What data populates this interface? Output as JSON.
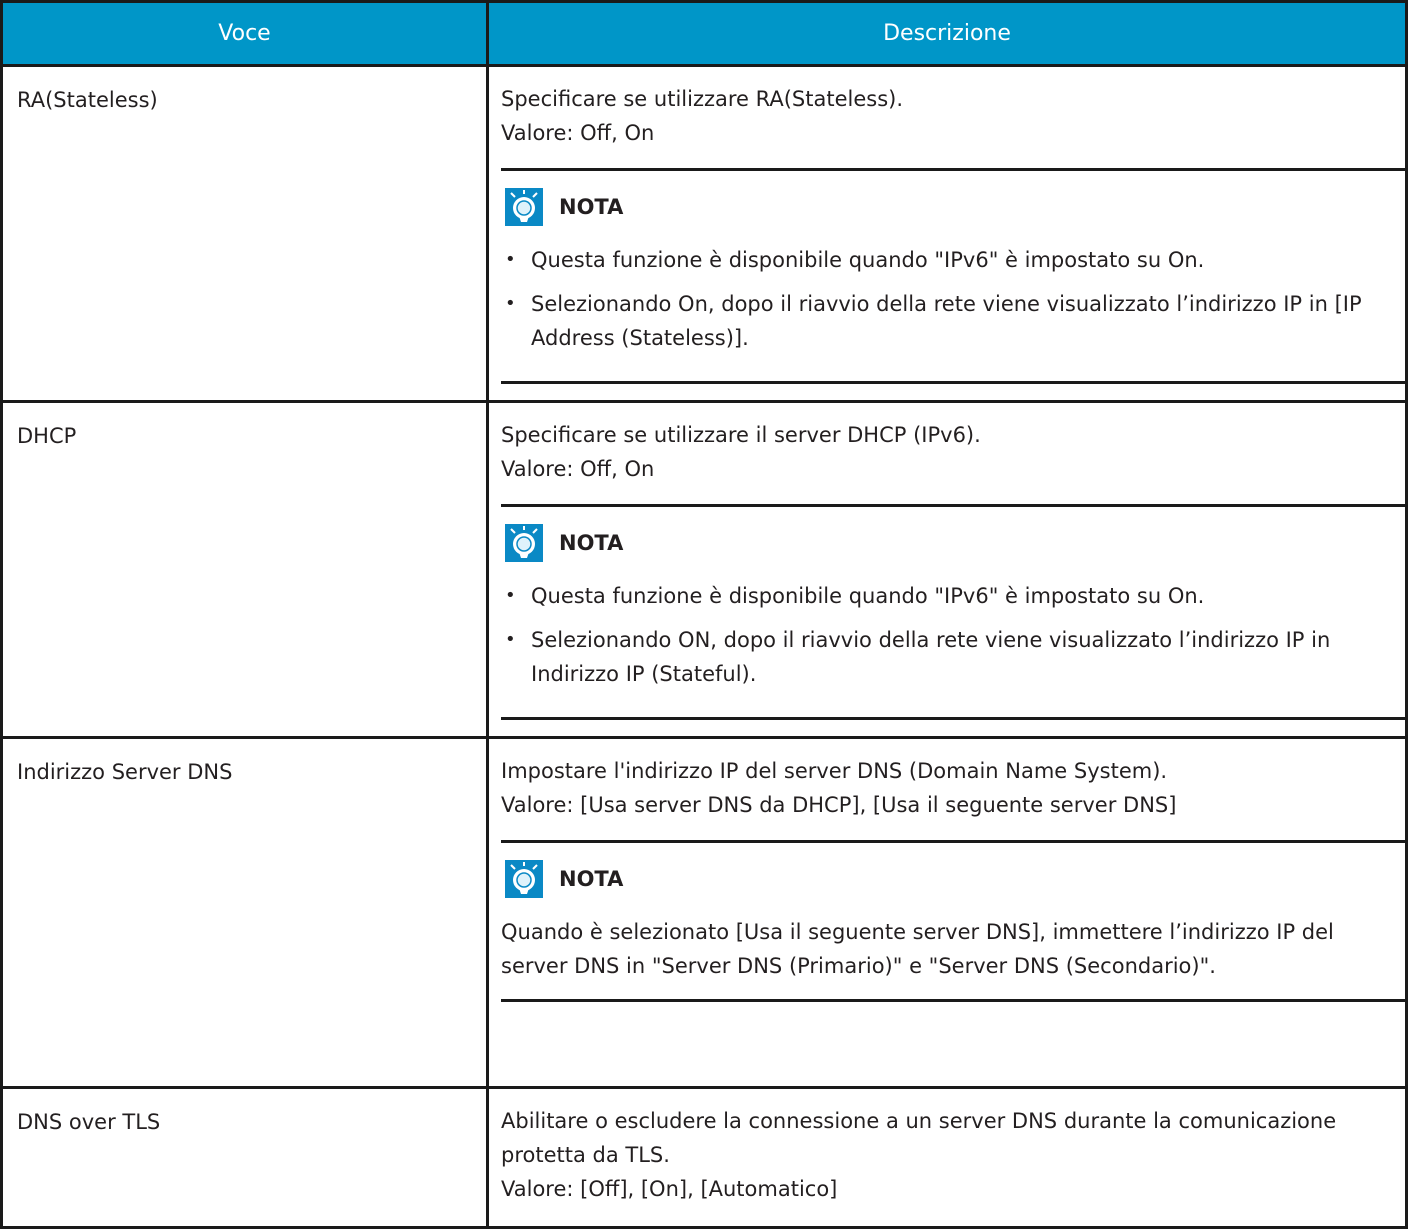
{
  "header": {
    "col_item": "Voce",
    "col_desc": "Descrizione"
  },
  "note_label": "NOTA",
  "rows": [
    {
      "item": "RA(Stateless)",
      "desc": "Specificare se utilizzare RA(Stateless).",
      "value": "Valore: Off, On",
      "note_bullets": [
        "Questa funzione è disponibile quando \"IPv6\" è impostato su On.",
        "Selezionando On, dopo il riavvio della rete viene visualizzato l’indirizzo IP in [IP Address (Stateless)]."
      ]
    },
    {
      "item": "DHCP",
      "desc": "Specificare se utilizzare il server DHCP (IPv6).",
      "value": "Valore: Off, On",
      "note_bullets": [
        "Questa funzione è disponibile quando \"IPv6\" è impostato su On.",
        "Selezionando ON, dopo il riavvio della rete viene visualizzato l’indirizzo IP in Indirizzo IP (Stateful)."
      ]
    },
    {
      "item": "Indirizzo Server DNS",
      "desc": "Impostare l'indirizzo IP del server DNS (Domain Name System).",
      "value": "Valore: [Usa server DNS da DHCP], [Usa il seguente server DNS]",
      "note_text": "Quando è selezionato [Usa il seguente server DNS], immettere l’indirizzo IP del server DNS in \"Server DNS (Primario)\" e \"Server DNS (Secondario)\"."
    },
    {
      "item": "DNS over TLS",
      "desc": "Abilitare o escludere la connessione a un server DNS durante la comunicazione protetta da TLS.",
      "value": "Valore: [Off], [On], [Automatico]"
    }
  ]
}
